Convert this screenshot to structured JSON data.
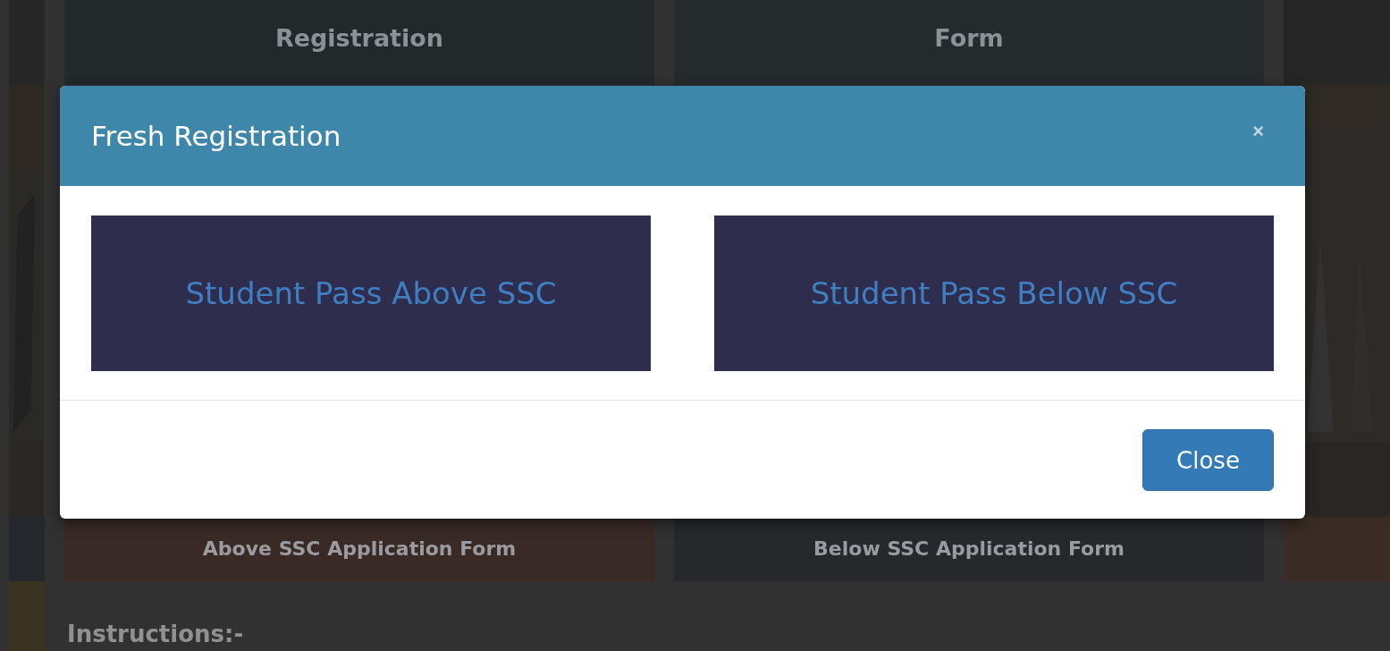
{
  "background_tiles_top": [
    {
      "text": "Registration"
    },
    {
      "text": "Form"
    }
  ],
  "background_tiles_bottom": [
    {
      "text": "Above SSC Application Form"
    },
    {
      "text": "Below SSC Application Form"
    }
  ],
  "instructions": {
    "heading": "Instructions:-"
  },
  "modal": {
    "title": "Fresh Registration",
    "close_icon": "×",
    "options": [
      {
        "label": "Student Pass Above SSC"
      },
      {
        "label": "Student Pass Below SSC"
      }
    ],
    "footer_button": "Close"
  }
}
